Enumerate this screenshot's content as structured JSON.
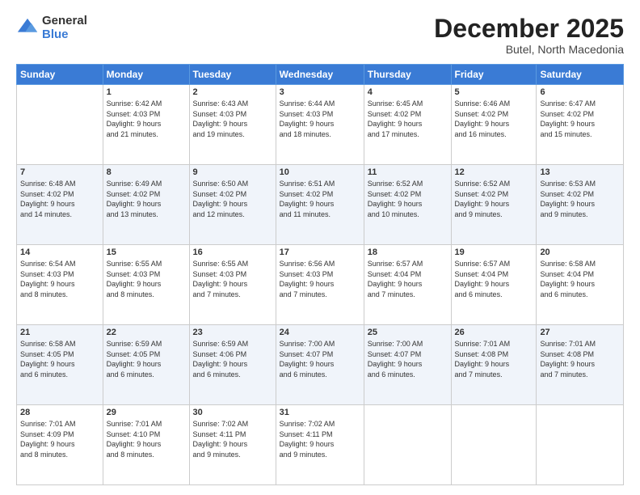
{
  "logo": {
    "general": "General",
    "blue": "Blue"
  },
  "header": {
    "month": "December 2025",
    "location": "Butel, North Macedonia"
  },
  "days_of_week": [
    "Sunday",
    "Monday",
    "Tuesday",
    "Wednesday",
    "Thursday",
    "Friday",
    "Saturday"
  ],
  "weeks": [
    [
      {
        "day": "",
        "info": ""
      },
      {
        "day": "1",
        "info": "Sunrise: 6:42 AM\nSunset: 4:03 PM\nDaylight: 9 hours\nand 21 minutes."
      },
      {
        "day": "2",
        "info": "Sunrise: 6:43 AM\nSunset: 4:03 PM\nDaylight: 9 hours\nand 19 minutes."
      },
      {
        "day": "3",
        "info": "Sunrise: 6:44 AM\nSunset: 4:03 PM\nDaylight: 9 hours\nand 18 minutes."
      },
      {
        "day": "4",
        "info": "Sunrise: 6:45 AM\nSunset: 4:02 PM\nDaylight: 9 hours\nand 17 minutes."
      },
      {
        "day": "5",
        "info": "Sunrise: 6:46 AM\nSunset: 4:02 PM\nDaylight: 9 hours\nand 16 minutes."
      },
      {
        "day": "6",
        "info": "Sunrise: 6:47 AM\nSunset: 4:02 PM\nDaylight: 9 hours\nand 15 minutes."
      }
    ],
    [
      {
        "day": "7",
        "info": "Sunrise: 6:48 AM\nSunset: 4:02 PM\nDaylight: 9 hours\nand 14 minutes."
      },
      {
        "day": "8",
        "info": "Sunrise: 6:49 AM\nSunset: 4:02 PM\nDaylight: 9 hours\nand 13 minutes."
      },
      {
        "day": "9",
        "info": "Sunrise: 6:50 AM\nSunset: 4:02 PM\nDaylight: 9 hours\nand 12 minutes."
      },
      {
        "day": "10",
        "info": "Sunrise: 6:51 AM\nSunset: 4:02 PM\nDaylight: 9 hours\nand 11 minutes."
      },
      {
        "day": "11",
        "info": "Sunrise: 6:52 AM\nSunset: 4:02 PM\nDaylight: 9 hours\nand 10 minutes."
      },
      {
        "day": "12",
        "info": "Sunrise: 6:52 AM\nSunset: 4:02 PM\nDaylight: 9 hours\nand 9 minutes."
      },
      {
        "day": "13",
        "info": "Sunrise: 6:53 AM\nSunset: 4:02 PM\nDaylight: 9 hours\nand 9 minutes."
      }
    ],
    [
      {
        "day": "14",
        "info": "Sunrise: 6:54 AM\nSunset: 4:03 PM\nDaylight: 9 hours\nand 8 minutes."
      },
      {
        "day": "15",
        "info": "Sunrise: 6:55 AM\nSunset: 4:03 PM\nDaylight: 9 hours\nand 8 minutes."
      },
      {
        "day": "16",
        "info": "Sunrise: 6:55 AM\nSunset: 4:03 PM\nDaylight: 9 hours\nand 7 minutes."
      },
      {
        "day": "17",
        "info": "Sunrise: 6:56 AM\nSunset: 4:03 PM\nDaylight: 9 hours\nand 7 minutes."
      },
      {
        "day": "18",
        "info": "Sunrise: 6:57 AM\nSunset: 4:04 PM\nDaylight: 9 hours\nand 7 minutes."
      },
      {
        "day": "19",
        "info": "Sunrise: 6:57 AM\nSunset: 4:04 PM\nDaylight: 9 hours\nand 6 minutes."
      },
      {
        "day": "20",
        "info": "Sunrise: 6:58 AM\nSunset: 4:04 PM\nDaylight: 9 hours\nand 6 minutes."
      }
    ],
    [
      {
        "day": "21",
        "info": "Sunrise: 6:58 AM\nSunset: 4:05 PM\nDaylight: 9 hours\nand 6 minutes."
      },
      {
        "day": "22",
        "info": "Sunrise: 6:59 AM\nSunset: 4:05 PM\nDaylight: 9 hours\nand 6 minutes."
      },
      {
        "day": "23",
        "info": "Sunrise: 6:59 AM\nSunset: 4:06 PM\nDaylight: 9 hours\nand 6 minutes."
      },
      {
        "day": "24",
        "info": "Sunrise: 7:00 AM\nSunset: 4:07 PM\nDaylight: 9 hours\nand 6 minutes."
      },
      {
        "day": "25",
        "info": "Sunrise: 7:00 AM\nSunset: 4:07 PM\nDaylight: 9 hours\nand 6 minutes."
      },
      {
        "day": "26",
        "info": "Sunrise: 7:01 AM\nSunset: 4:08 PM\nDaylight: 9 hours\nand 7 minutes."
      },
      {
        "day": "27",
        "info": "Sunrise: 7:01 AM\nSunset: 4:08 PM\nDaylight: 9 hours\nand 7 minutes."
      }
    ],
    [
      {
        "day": "28",
        "info": "Sunrise: 7:01 AM\nSunset: 4:09 PM\nDaylight: 9 hours\nand 8 minutes."
      },
      {
        "day": "29",
        "info": "Sunrise: 7:01 AM\nSunset: 4:10 PM\nDaylight: 9 hours\nand 8 minutes."
      },
      {
        "day": "30",
        "info": "Sunrise: 7:02 AM\nSunset: 4:11 PM\nDaylight: 9 hours\nand 9 minutes."
      },
      {
        "day": "31",
        "info": "Sunrise: 7:02 AM\nSunset: 4:11 PM\nDaylight: 9 hours\nand 9 minutes."
      },
      {
        "day": "",
        "info": ""
      },
      {
        "day": "",
        "info": ""
      },
      {
        "day": "",
        "info": ""
      }
    ]
  ]
}
